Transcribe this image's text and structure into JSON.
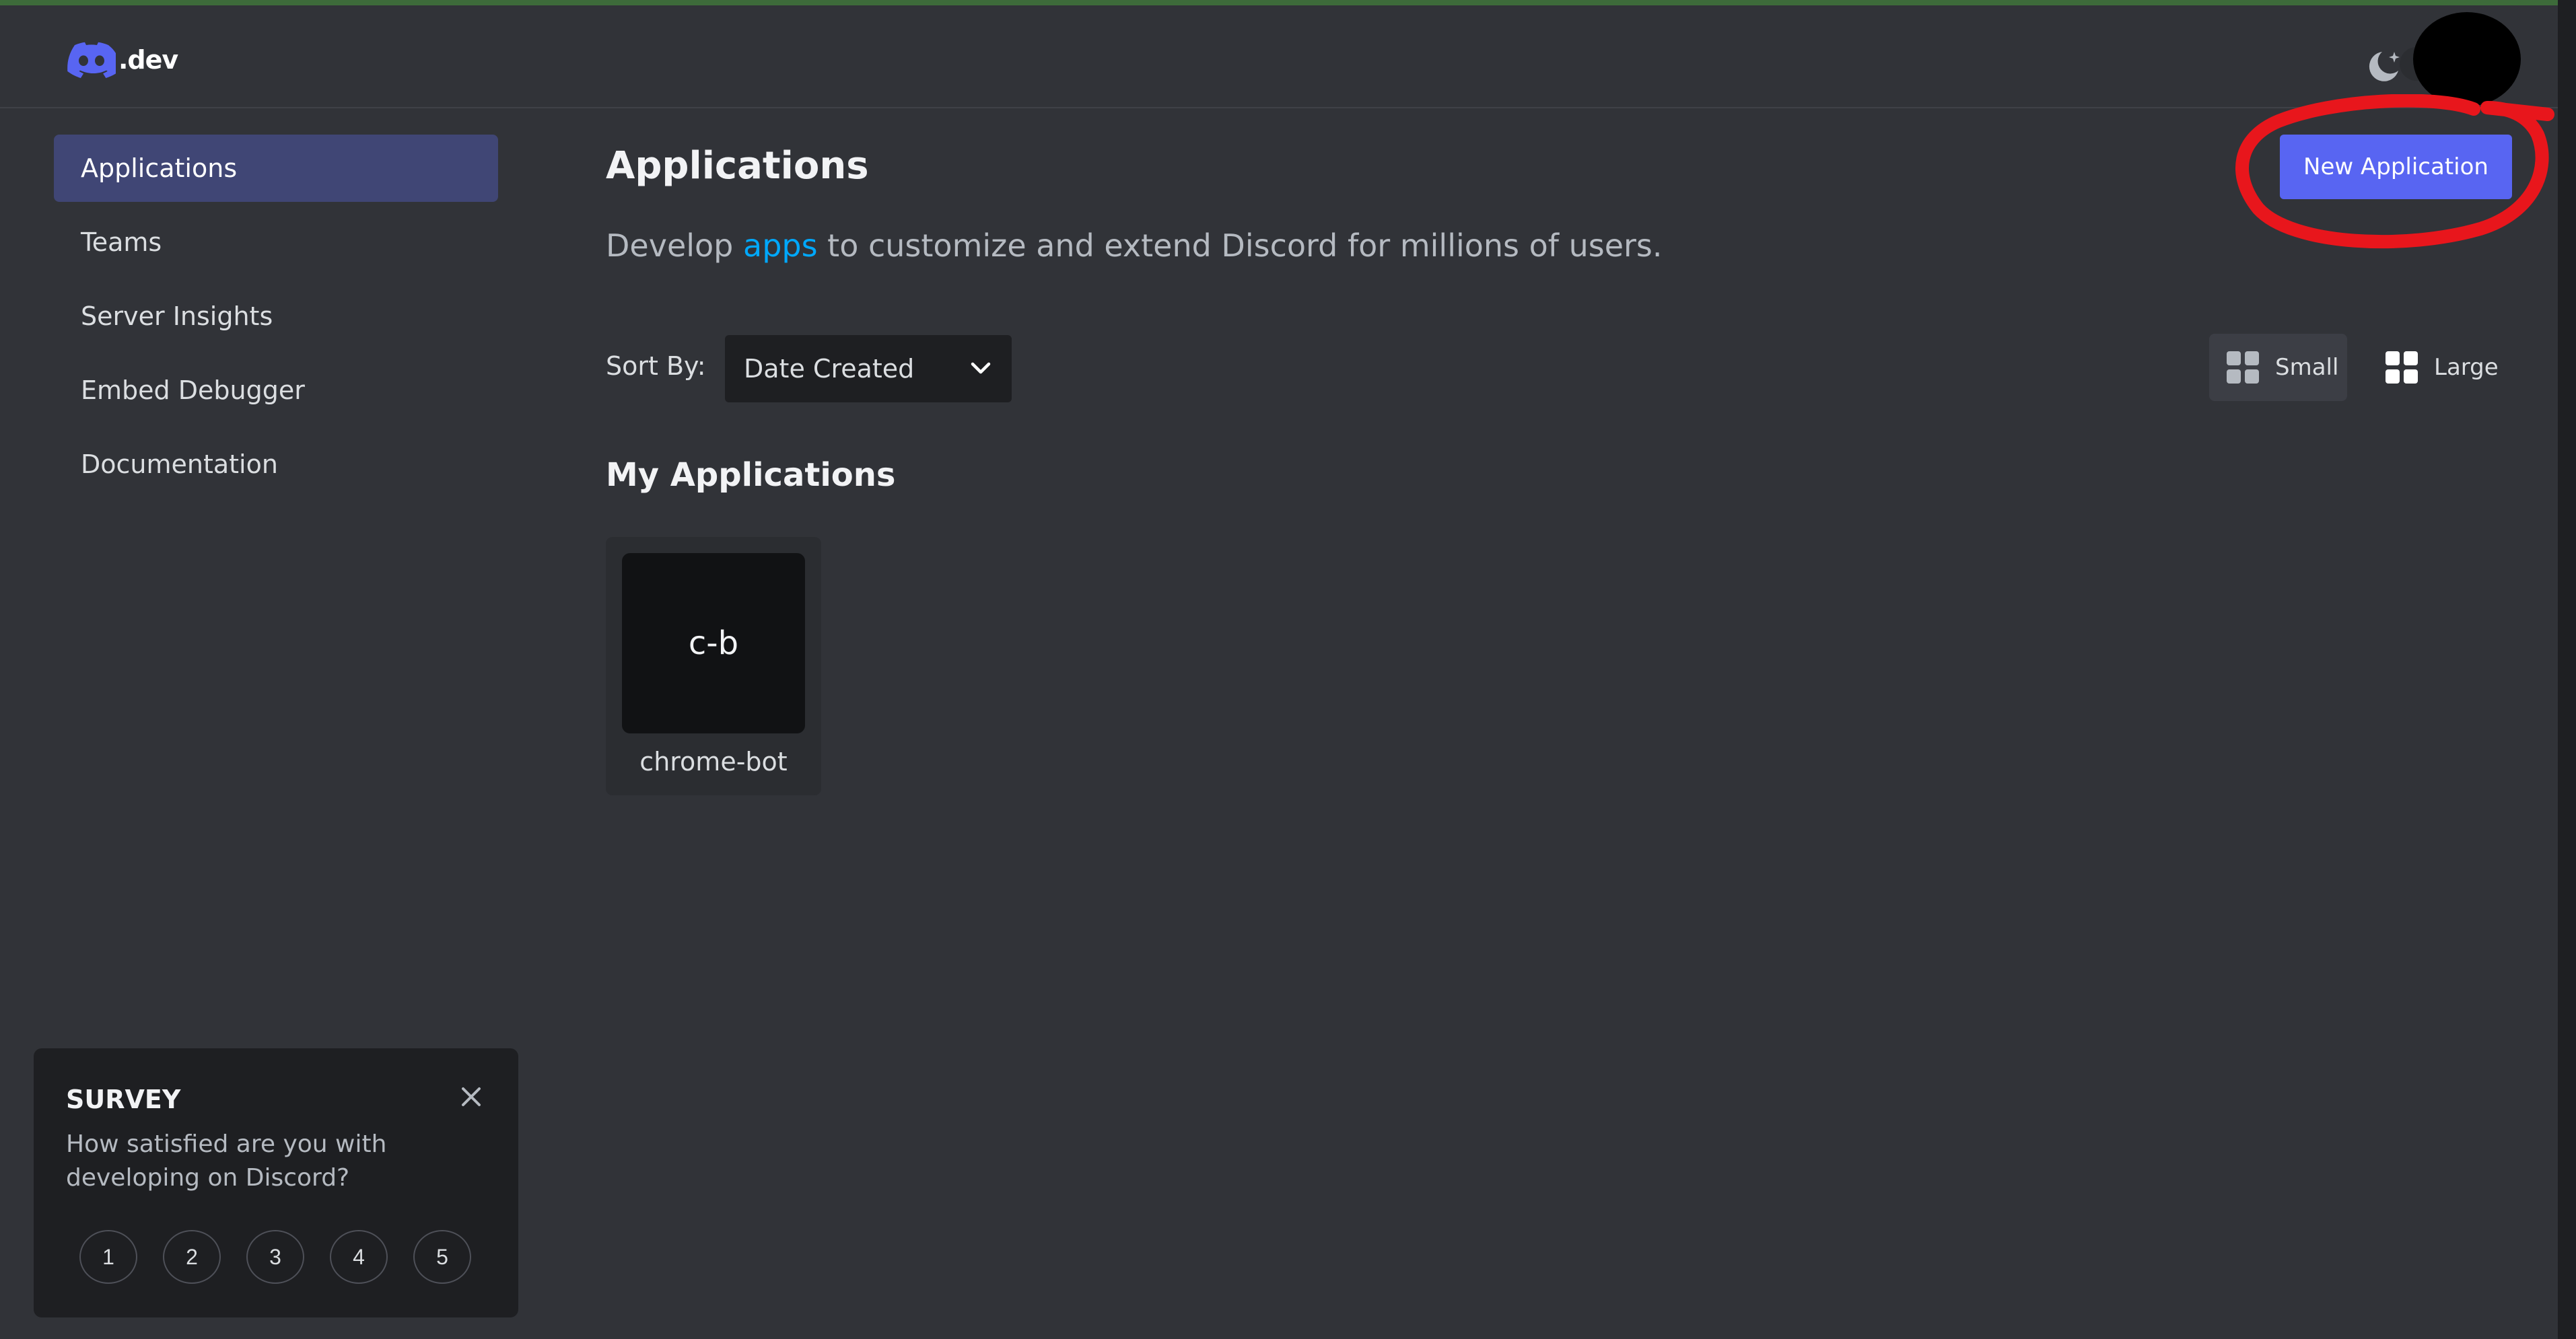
{
  "header": {
    "logo_text": ".dev",
    "theme_icon": "moon-sparkle-icon",
    "brand_color": "#5865f2"
  },
  "sidebar": {
    "items": [
      {
        "label": "Applications",
        "active": true
      },
      {
        "label": "Teams",
        "active": false
      },
      {
        "label": "Server Insights",
        "active": false
      },
      {
        "label": "Embed Debugger",
        "active": false
      },
      {
        "label": "Documentation",
        "active": false
      }
    ]
  },
  "main": {
    "title": "Applications",
    "subtitle_before": "Develop ",
    "subtitle_link": "apps",
    "subtitle_after": " to customize and extend Discord for millions of users.",
    "new_app_label": "New Application",
    "sort_label": "Sort By:",
    "sort_value": "Date Created",
    "view_small_label": "Small",
    "view_large_label": "Large",
    "section_title": "My Applications",
    "apps": [
      {
        "initials": "c-b",
        "name": "chrome-bot"
      }
    ]
  },
  "survey": {
    "title": "SURVEY",
    "question": "How satisfied are you with developing on Discord?",
    "ratings": [
      "1",
      "2",
      "3",
      "4",
      "5"
    ]
  }
}
